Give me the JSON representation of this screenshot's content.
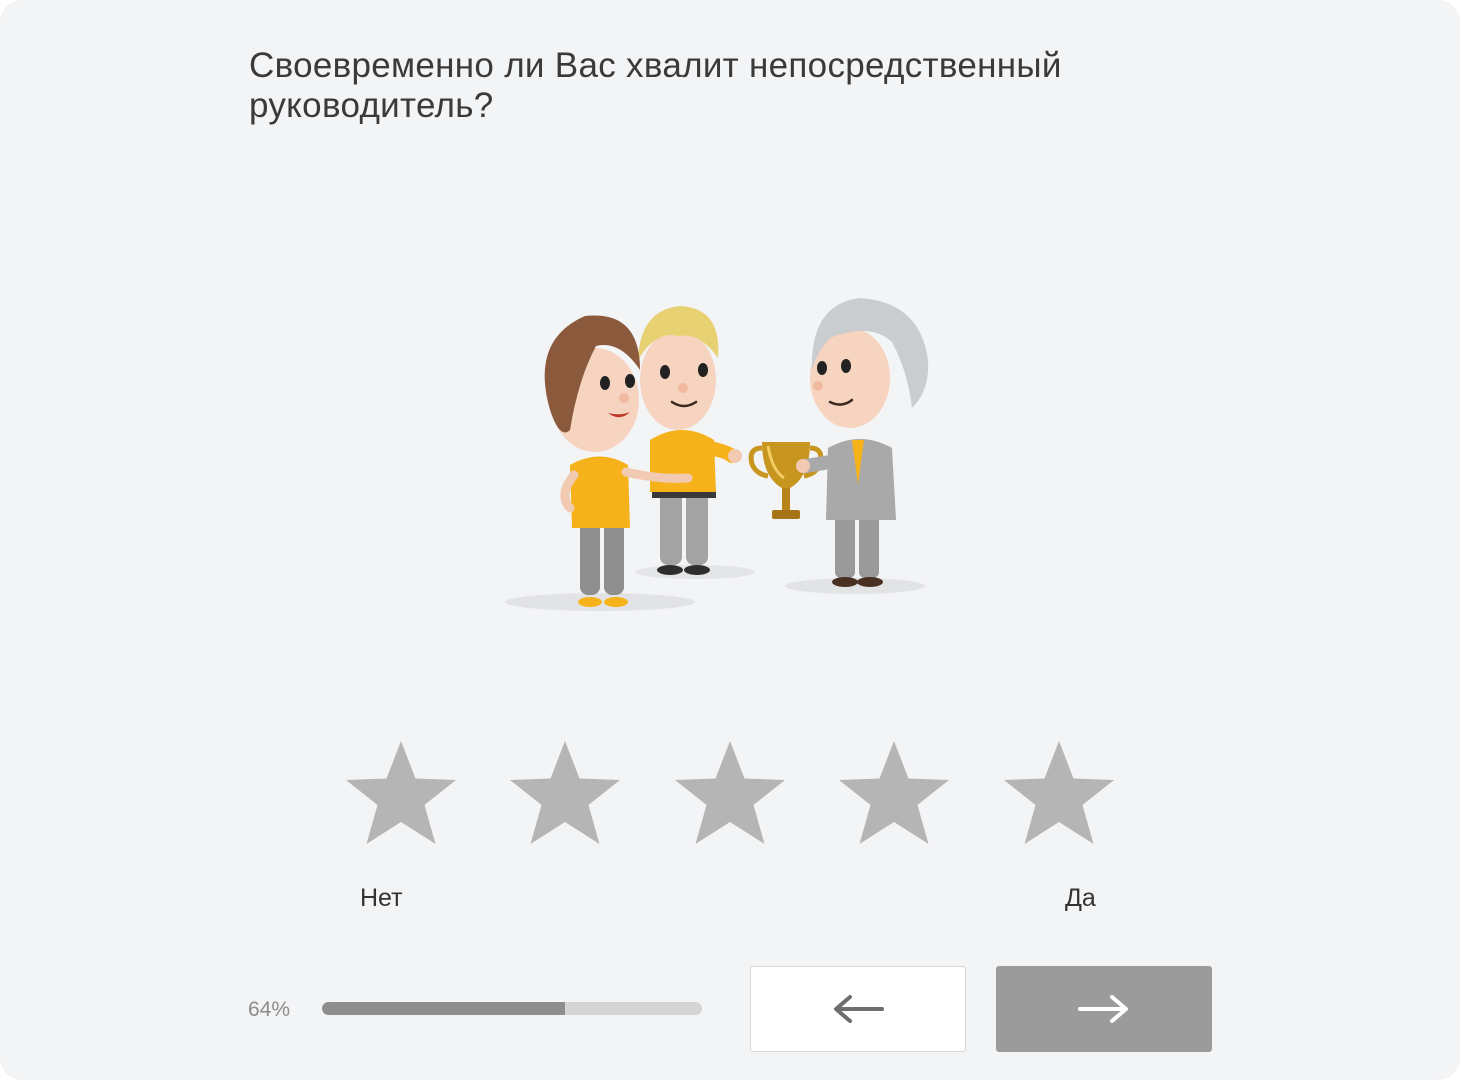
{
  "question": {
    "line1": "Своевременно ли Вас хвалит непосредственный",
    "line2": "руководитель?"
  },
  "illustration": {
    "icon": "people-award-trophy-illustration"
  },
  "rating": {
    "max": 5,
    "selected": 0,
    "star_icon": "star-icon",
    "star_color": "#b5b5b5",
    "label_min": "Нет",
    "label_max": "Да"
  },
  "progress": {
    "text": "64%",
    "value": 0.64,
    "track_color": "#d4d4d4",
    "fill_color": "#8e8e8e"
  },
  "navigation": {
    "back_icon": "arrow-left-icon",
    "next_icon": "arrow-right-icon",
    "next_bg": "#9b9b9b"
  }
}
